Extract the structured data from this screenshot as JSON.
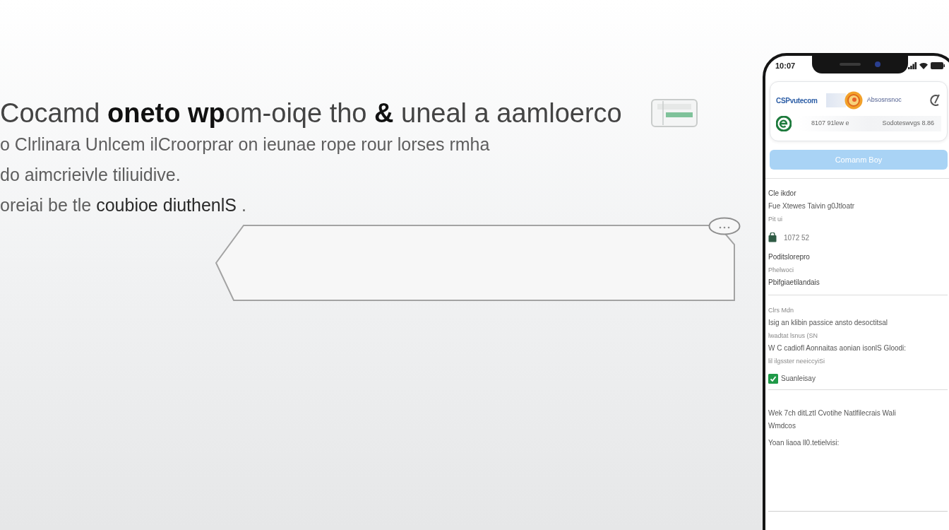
{
  "headline": "Cocamd **oneto wp**om-oiqe tho **&** uneal a aamloerco",
  "description": [
    "o Clrlinara Unlcem  ilCroorprar on ieunae rope rour lorses rmha",
    "do aimcrieivle tiliuidive.",
    "oreiai be tle **coubioe diuthenlS** ."
  ],
  "phone": {
    "status_bar": {
      "time": "10:07"
    },
    "header_card": {
      "brand": "CSPvutecom",
      "partner": "Absosnsnoc",
      "account": [
        "8107 91lew e",
        "Sodoteswvgs 8.86"
      ]
    },
    "button": "Comanm Boy",
    "sections": [
      {
        "items": [
          {
            "kind": "heading",
            "text": "Cle ikdor"
          },
          {
            "kind": "text",
            "text": "Fue Xtewes Taivin g0Jtloatr"
          },
          {
            "kind": "note",
            "text": "Pit ui"
          },
          {
            "kind": "icon",
            "text": "1072 52"
          },
          {
            "kind": "heading",
            "text": "Poditslorepro"
          },
          {
            "kind": "note",
            "text": "Phelwoci"
          },
          {
            "kind": "heading",
            "text": "Pbifgiaetilandais"
          }
        ]
      },
      {
        "items": [
          {
            "kind": "note",
            "text": "Clrs Mdn"
          },
          {
            "kind": "text",
            "text": "Isig an klibin passice ansto desoctitsal"
          },
          {
            "kind": "note",
            "text": "lwadtat lsnus (SN"
          },
          {
            "kind": "text",
            "text": "W C cadiofl Aonnaitas aonian isonlS Gloodi:"
          },
          {
            "kind": "note",
            "text": "lil ilgsster neeiccyiSi"
          },
          {
            "kind": "check",
            "text": "Suanleisay",
            "checked": true
          }
        ]
      },
      {
        "items": [
          {
            "kind": "text",
            "text": "Wek 7ch ditLztl Cvotihe Natlfilecrais Wali"
          },
          {
            "kind": "text",
            "text": "Wmdcos"
          },
          {
            "kind": "gap-text",
            "text": "Yoan liaoa ll0.tetielvisi:"
          }
        ]
      }
    ]
  }
}
